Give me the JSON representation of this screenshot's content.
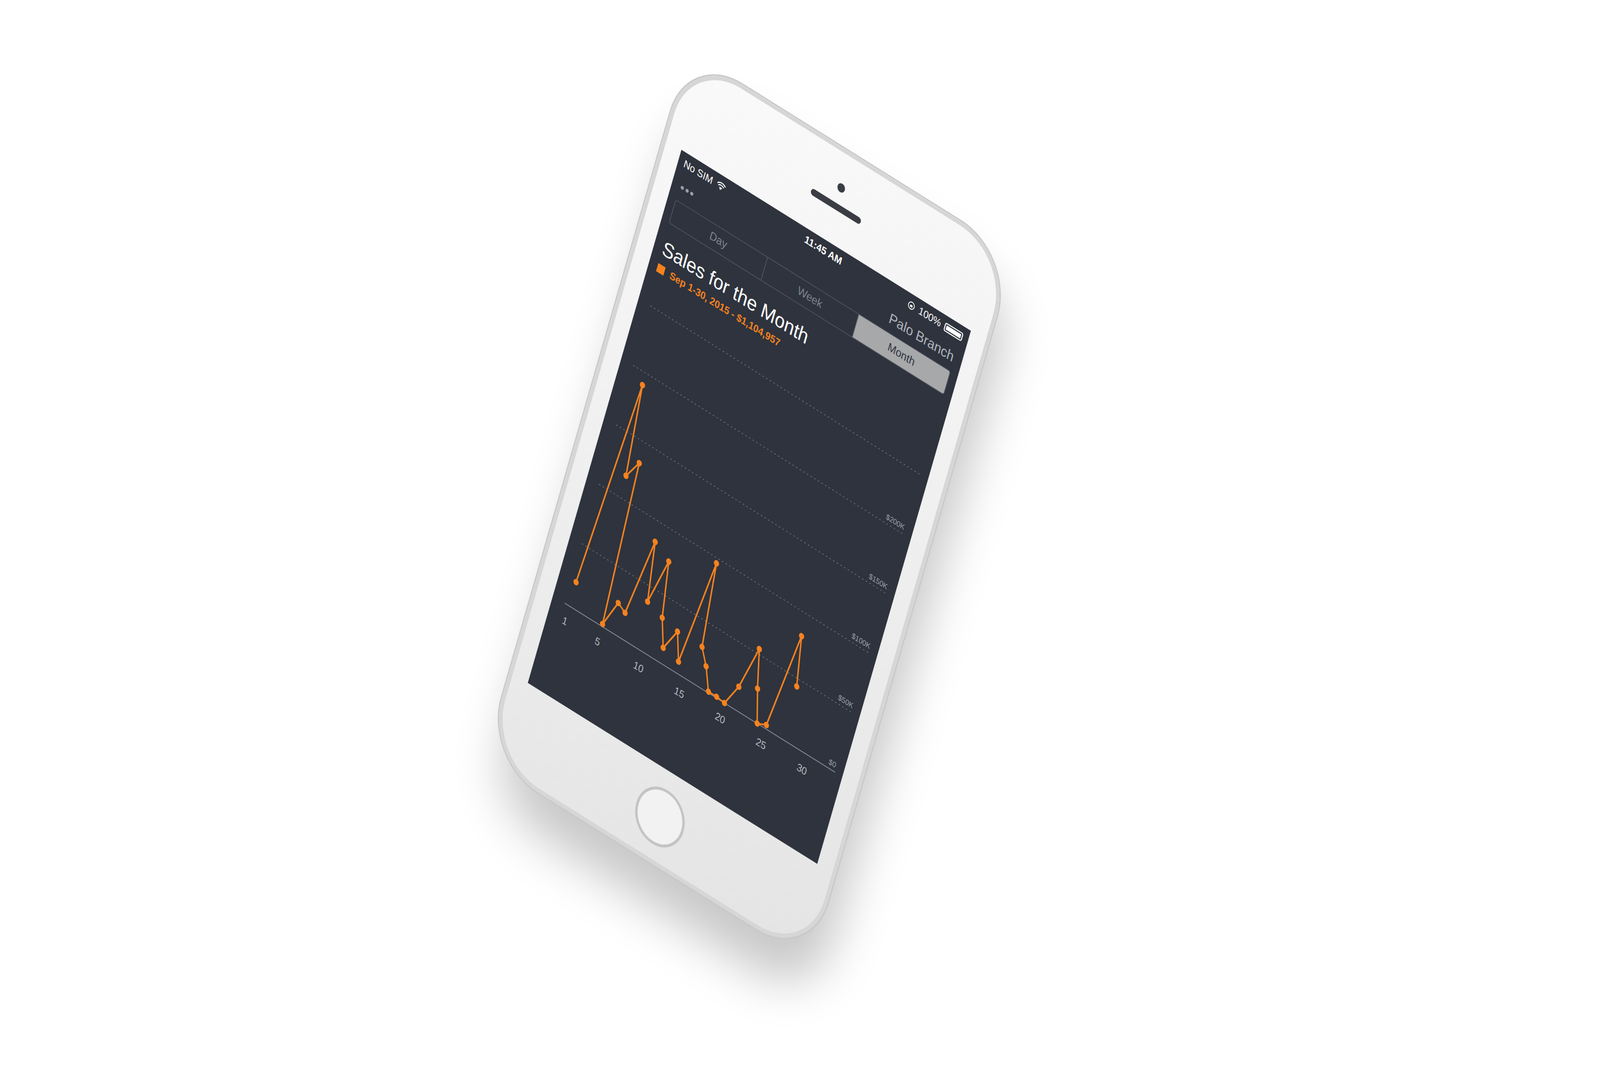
{
  "status_bar": {
    "carrier": "No SIM",
    "time": "11:45 AM",
    "battery": "100%",
    "battery_level": 1.0
  },
  "nav": {
    "menu": "•••",
    "title": "Palo Branch"
  },
  "tabs": [
    {
      "label": "Day",
      "selected": false
    },
    {
      "label": "Week",
      "selected": false
    },
    {
      "label": "Month",
      "selected": true
    }
  ],
  "chart": {
    "title": "Sales for the Month",
    "legend": [
      {
        "label": "Sep 1-30, 2015 - $1,104,957",
        "color": "#f5821f"
      }
    ],
    "series": [
      {
        "name": "Sales",
        "color": "#f5821f",
        "values": [
          20000,
          190000,
          118000,
          133000,
          2000,
          24000,
          20000,
          84000,
          38000,
          76000,
          33000,
          12000,
          30000,
          9000,
          96000,
          30000,
          18000,
          1000,
          1000,
          0,
          18000,
          54000,
          25000,
          0,
          3000,
          82000,
          44000
        ]
      }
    ],
    "x_ticks": [
      {
        "label": "1",
        "day": 1
      },
      {
        "label": "5",
        "day": 5
      },
      {
        "label": "10",
        "day": 10
      },
      {
        "label": "15",
        "day": 15
      },
      {
        "label": "20",
        "day": 20
      },
      {
        "label": "25",
        "day": 25
      },
      {
        "label": "30",
        "day": 30
      }
    ],
    "y_ticks": [
      {
        "label": "$0",
        "value": 0
      },
      {
        "label": "$50K",
        "value": 50000
      },
      {
        "label": "$100K",
        "value": 100000
      },
      {
        "label": "$150K",
        "value": 150000
      },
      {
        "label": "$200K",
        "value": 200000
      }
    ]
  }
}
